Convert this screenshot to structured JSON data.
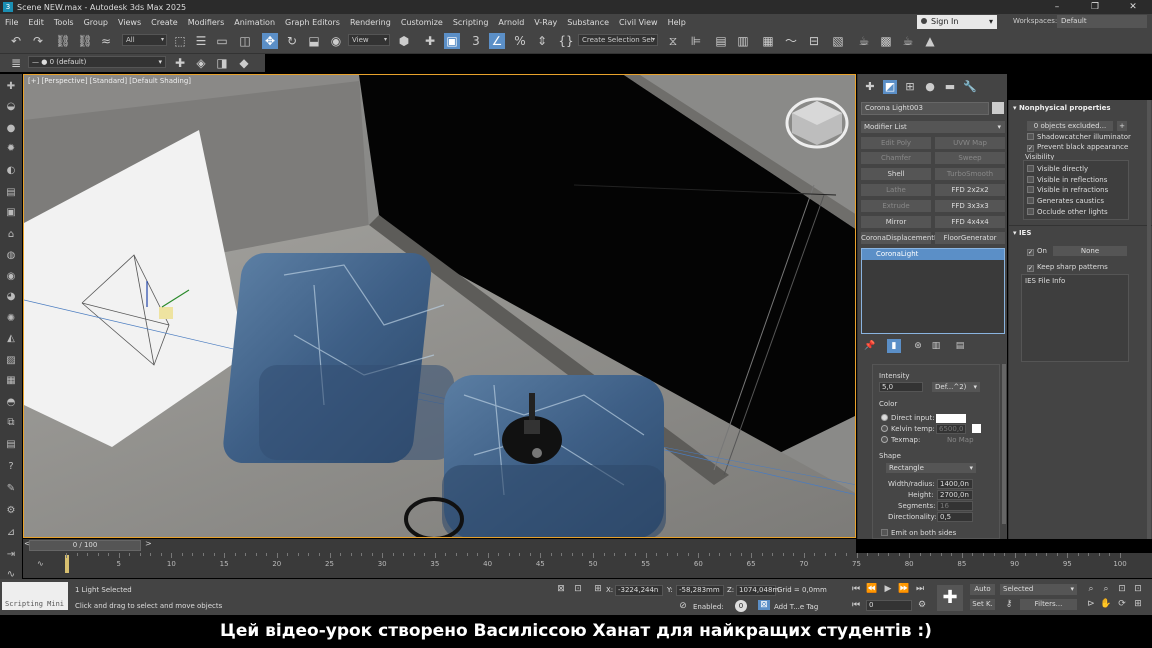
{
  "window": {
    "title": "Scene NEW.max - Autodesk 3ds Max 2025",
    "buttons": [
      "–",
      "❐",
      "✕"
    ]
  },
  "menu": [
    "File",
    "Edit",
    "Tools",
    "Group",
    "Views",
    "Create",
    "Modifiers",
    "Animation",
    "Graph Editors",
    "Rendering",
    "Customize",
    "Scripting",
    "Arnold",
    "V-Ray",
    "Substance",
    "Civil View",
    "Help"
  ],
  "account": {
    "signin": "Sign In",
    "workspaces_label": "Workspaces:",
    "workspace": "Default"
  },
  "toolbar": {
    "selection_filter": "All",
    "ref_coord": "View",
    "selection_set": "Create Selection Set"
  },
  "layer": {
    "current": "0 (default)"
  },
  "viewport": {
    "label": "[+] [Perspective] [Standard] [Default Shading]"
  },
  "timeline": {
    "slider": "0 / 100",
    "ticks": [
      "0",
      "5",
      "10",
      "15",
      "20",
      "25",
      "30",
      "35",
      "40",
      "45",
      "50",
      "55",
      "60",
      "65",
      "70",
      "75",
      "80",
      "85",
      "90",
      "95",
      "100"
    ]
  },
  "status": {
    "maxscript": "Scripting Mini",
    "selected": "1 Light Selected",
    "prompt": "Click and drag to select and move objects",
    "x_label": "X:",
    "x": "-3224,244n",
    "y_label": "Y:",
    "y": "-58,283mm",
    "z_label": "Z:",
    "z": "1074,048m",
    "grid": "Grid = 0,0mm",
    "enabled": "Enabled:",
    "add_tag": "Add T...e Tag",
    "auto": "Auto",
    "set_key": "Set K.",
    "selected_drop": "Selected",
    "filters": "Filters...",
    "frame": "0"
  },
  "command_panel": {
    "object_name": "Corona Light003",
    "modifier_list": "Modifier List",
    "modifier_buttons": [
      [
        "Edit Poly",
        "UVW Map"
      ],
      [
        "Chamfer",
        "Sweep"
      ],
      [
        "Shell",
        "TurboSmooth"
      ],
      [
        "Lathe",
        "FFD 2x2x2"
      ],
      [
        "Extrude",
        "FFD 3x3x3"
      ],
      [
        "Mirror",
        "FFD 4x4x4"
      ],
      [
        "CoronaDisplacementM",
        "FloorGenerator"
      ]
    ],
    "stack_item": "CoronaLight",
    "intensity_label": "Intensity",
    "intensity_value": "5,0",
    "intensity_unit": "Def...^2)",
    "color_label": "Color",
    "direct_input": "Direct input:",
    "kelvin_temp": "Kelvin temp:",
    "kelvin_value": "6500,0",
    "texmap": "Texmap:",
    "no_map": "No Map",
    "shape_label": "Shape",
    "shape_value": "Rectangle",
    "width_label": "Width/radius:",
    "width_value": "1400,0n",
    "height_label": "Height:",
    "height_value": "2700,0n",
    "segments_label": "Segments:",
    "segments_value": "16",
    "directionality_label": "Directionality:",
    "directionality_value": "0,5",
    "emit_both": "Emit on both sides"
  },
  "right_panel": {
    "nonphys_title": "Nonphysical properties",
    "excluded": "0 objects excluded...",
    "plus": "+",
    "shadowcatcher": "Shadowcatcher illuminator",
    "prevent_black": "Prevent black appearance",
    "visibility": "Visibility",
    "vis_items": [
      "Visible directly",
      "Visible in reflections",
      "Visible in refractions",
      "Generates caustics",
      "Occlude other lights"
    ],
    "ies_title": "IES",
    "ies_on": "On",
    "ies_none": "None",
    "keep_sharp": "Keep sharp patterns",
    "ies_file_info": "IES File Info"
  },
  "subtitle": "Цей відео-урок створено Василіссою Ханат для найкращих студентів :)"
}
